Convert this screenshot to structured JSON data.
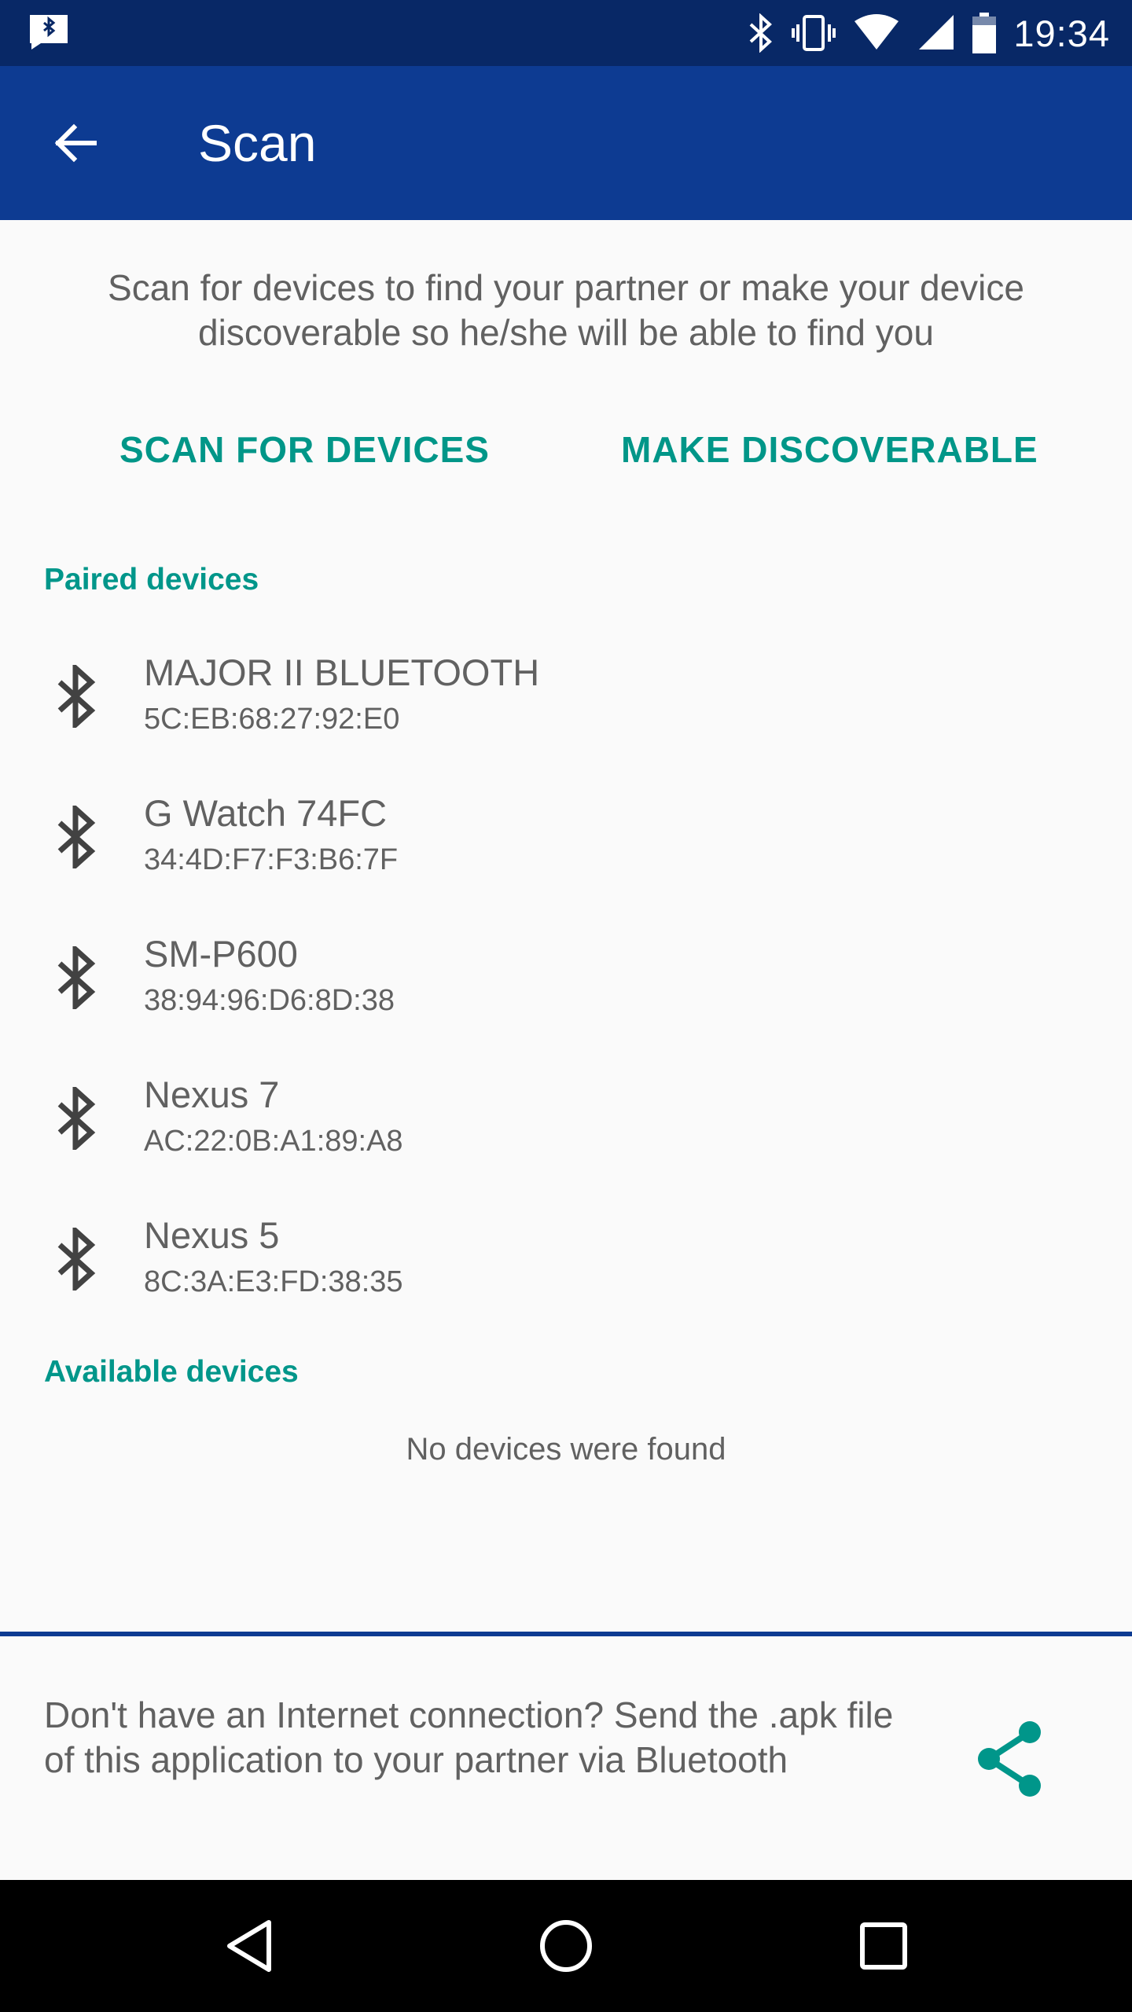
{
  "status_bar": {
    "time": "19:34",
    "icons": [
      "bluetooth-notification-icon",
      "bluetooth-icon",
      "vibrate-icon",
      "wifi-icon",
      "signal-icon",
      "battery-icon"
    ]
  },
  "app_bar": {
    "title": "Scan",
    "back_icon": "arrow-back-icon"
  },
  "intro": {
    "text": "Scan for devices to find your partner or make your device discoverable so he/she will be able to find you"
  },
  "actions": {
    "scan_label": "SCAN FOR DEVICES",
    "discover_label": "MAKE DISCOVERABLE"
  },
  "paired": {
    "header": "Paired devices",
    "devices": [
      {
        "name": "MAJOR II BLUETOOTH",
        "mac": "5C:EB:68:27:92:E0"
      },
      {
        "name": "G Watch 74FC",
        "mac": "34:4D:F7:F3:B6:7F"
      },
      {
        "name": "SM-P600",
        "mac": "38:94:96:D6:8D:38"
      },
      {
        "name": "Nexus 7",
        "mac": "AC:22:0B:A1:89:A8"
      },
      {
        "name": "Nexus 5",
        "mac": "8C:3A:E3:FD:38:35"
      }
    ]
  },
  "available": {
    "header": "Available devices",
    "empty_text": "No devices were found"
  },
  "bottom": {
    "text": "Don't have an Internet connection? Send the .apk file of this application to your partner via Bluetooth",
    "share_icon": "share-icon"
  },
  "colors": {
    "status_bar": "#082866",
    "app_bar": "#0d3b92",
    "accent": "#009688",
    "text": "#616161",
    "background": "#fafafa"
  }
}
